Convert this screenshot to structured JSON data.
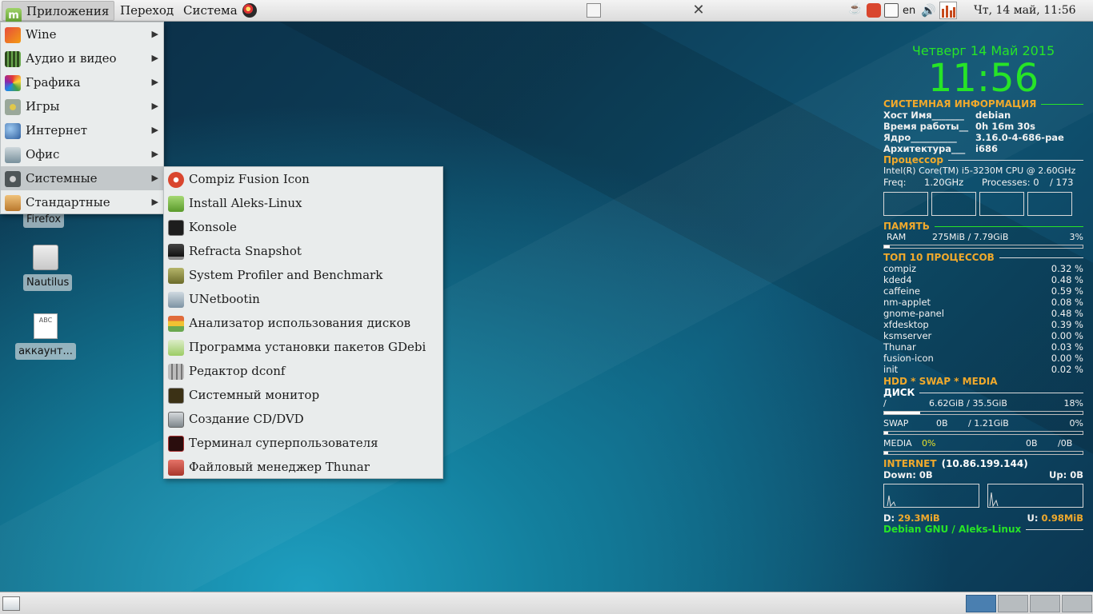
{
  "top_panel": {
    "applications": "Приложения",
    "places": "Переход",
    "system": "Система",
    "keyboard_layout": "en",
    "clock": "Чт, 14 май, 11:56"
  },
  "desktop": {
    "icons": [
      {
        "label": "Firefox",
        "icon": "firefox-icon"
      },
      {
        "label": "Nautilus",
        "icon": "nautilus-icon"
      },
      {
        "label": "аккаунт...",
        "icon": "text-document-icon"
      }
    ],
    "doc_icon_text": "ABC"
  },
  "app_menu": {
    "items": [
      {
        "label": "Wine",
        "icon": "wine-icon",
        "color": "#c0392b"
      },
      {
        "label": "Аудио и видео",
        "icon": "film-icon",
        "color": "#3d6b2b"
      },
      {
        "label": "Графика",
        "icon": "palette-icon",
        "color": "#e84a8a"
      },
      {
        "label": "Игры",
        "icon": "cards-icon",
        "color": "#9aa89a"
      },
      {
        "label": "Интернет",
        "icon": "globe-icon",
        "color": "#4b7cb5"
      },
      {
        "label": "Офис",
        "icon": "chart-icon",
        "color": "#7e8c95"
      },
      {
        "label": "Системные",
        "icon": "gear-icon",
        "color": "#5e6567"
      },
      {
        "label": "Стандартные",
        "icon": "calculator-icon",
        "color": "#c98a3a"
      }
    ]
  },
  "system_submenu": {
    "items": [
      {
        "label": "Compiz Fusion Icon",
        "icon": "compiz-icon",
        "color": "#d9462e"
      },
      {
        "label": "Install Aleks-Linux",
        "icon": "mint-installer-icon",
        "color": "#7ab648"
      },
      {
        "label": "Konsole",
        "icon": "terminal-icon",
        "color": "#222222"
      },
      {
        "label": "Refracta Snapshot",
        "icon": "monitor-icon",
        "color": "#333333"
      },
      {
        "label": "System Profiler and Benchmark",
        "icon": "profiler-icon",
        "color": "#8a8a3a"
      },
      {
        "label": "UNetbootin",
        "icon": "unetbootin-icon",
        "color": "#8fa3b3"
      },
      {
        "label": "Анализатор использования дисков",
        "icon": "disk-usage-icon",
        "color": "#d97d4a"
      },
      {
        "label": "Программа установки пакетов GDebi",
        "icon": "gdebi-icon",
        "color": "#9ccc65"
      },
      {
        "label": "Редактор dconf",
        "icon": "dconf-icon",
        "color": "#9e9e9e"
      },
      {
        "label": "Системный монитор",
        "icon": "system-monitor-icon",
        "color": "#6b5a2a"
      },
      {
        "label": "Создание CD/DVD",
        "icon": "cd-burner-icon",
        "color": "#8c9296"
      },
      {
        "label": "Терминал суперпользователя",
        "icon": "root-terminal-icon",
        "color": "#5a1f1f"
      },
      {
        "label": "Файловый менеджер Thunar",
        "icon": "thunar-icon",
        "color": "#b5453a"
      }
    ]
  },
  "conky": {
    "date": "Четверг 14 Май 2015",
    "time": "11:56",
    "sysinfo_title": "СИСТЕМНАЯ ИНФОРМАЦИЯ",
    "host_key": "Хост Имя_______",
    "host_val": "debian",
    "uptime_key": "Время работы__",
    "uptime_val": "0h 16m 30s",
    "kernel_key": "Ядро__________",
    "kernel_val": "3.16.0-4-686-pae",
    "arch_key": "Архитектура___",
    "arch_val": "i686",
    "cpu_title": "Процессор",
    "cpu_model": "Intel(R) Core(TM) i5-3230M CPU @ 2.60GHz",
    "freq_label": "Freq:",
    "freq_val": "1.20GHz",
    "processes_label": "Processes: 0",
    "processes_total": "/ 173",
    "mem_title": "ПАМЯТЬ",
    "ram_label": "RAM",
    "ram_val": "275MiB  / 7.79GiB",
    "ram_pct": "3%",
    "ram_fraction": 0.03,
    "top_title": "ТОП 10 ПРОЦЕССОВ",
    "processes": [
      {
        "name": "compiz",
        "cpu": "0.32 %"
      },
      {
        "name": "kded4",
        "cpu": "0.48 %"
      },
      {
        "name": "caffeine",
        "cpu": "0.59 %"
      },
      {
        "name": "nm-applet",
        "cpu": "0.08 %"
      },
      {
        "name": "gnome-panel",
        "cpu": "0.48 %"
      },
      {
        "name": "xfdesktop",
        "cpu": "0.39 %"
      },
      {
        "name": "ksmserver",
        "cpu": "0.00 %"
      },
      {
        "name": "Thunar",
        "cpu": "0.03 %"
      },
      {
        "name": "fusion-icon",
        "cpu": "0.00 %"
      },
      {
        "name": "init",
        "cpu": "0.02 %"
      }
    ],
    "hdd_title": "HDD * SWAP * MEDIA",
    "disk_title": "ДИСК",
    "root_label": "/",
    "root_val": "6.62GiB / 35.5GiB",
    "root_pct": "18%",
    "root_fraction": 0.18,
    "swap_label": "SWAP",
    "swap_used": "0B",
    "swap_total": "/ 1.21GiB",
    "swap_pct": "0%",
    "swap_fraction": 0.0,
    "media_label": "MEDIA",
    "media_pct": "0%",
    "media_used": "0B",
    "media_total": "/0B",
    "media_fraction": 0.0,
    "internet_title": "INTERNET",
    "ip": "(10.86.199.144)",
    "down_label": "Down: 0B",
    "up_label": "Up: 0B",
    "d_label": "D:",
    "d_val": "29.3MiB",
    "u_label": "U:",
    "u_val": "0.98MiB",
    "footer": "Debian GNU / Aleks-Linux"
  },
  "workspaces": {
    "count": 4,
    "active": 1
  },
  "colors": {
    "conky_green": "#27e427",
    "conky_orange": "#f0a92c",
    "menu_bg": "#e9ecec"
  }
}
